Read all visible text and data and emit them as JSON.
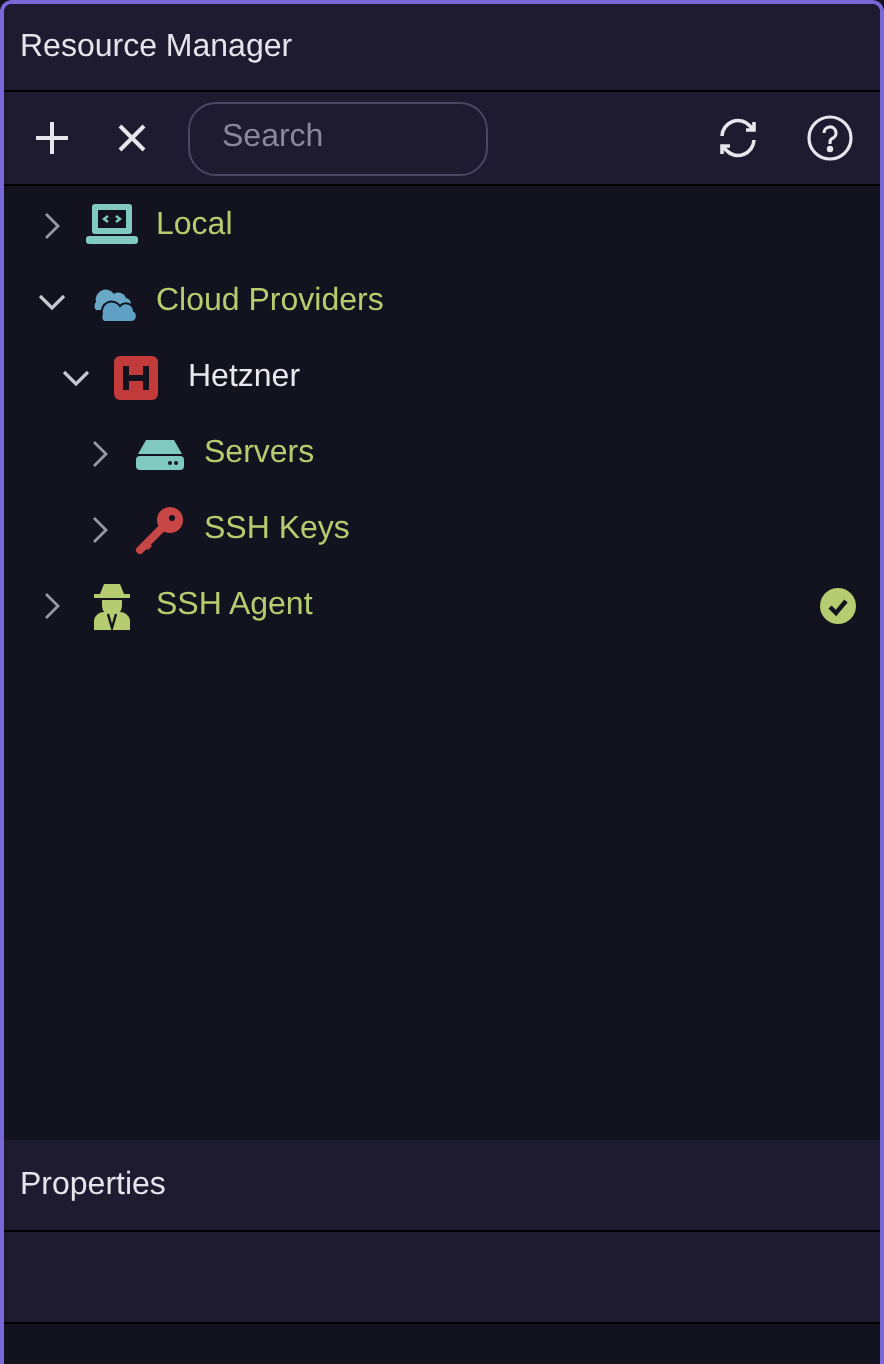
{
  "window": {
    "title": "Resource Manager"
  },
  "toolbar": {
    "search": {
      "placeholder": "Search"
    }
  },
  "tree": [
    {
      "label": "Local",
      "kind": "local",
      "expanded": false
    },
    {
      "label": "Cloud Providers",
      "kind": "cloud",
      "expanded": true,
      "children": [
        {
          "label": "Hetzner",
          "kind": "provider",
          "expanded": true,
          "children": [
            {
              "label": "Servers",
              "kind": "servers",
              "expanded": false
            },
            {
              "label": "SSH Keys",
              "kind": "keys",
              "expanded": false
            }
          ]
        }
      ]
    },
    {
      "label": "SSH Agent",
      "kind": "agent",
      "expanded": false,
      "connected": true
    }
  ],
  "properties": {
    "title": "Properties"
  }
}
